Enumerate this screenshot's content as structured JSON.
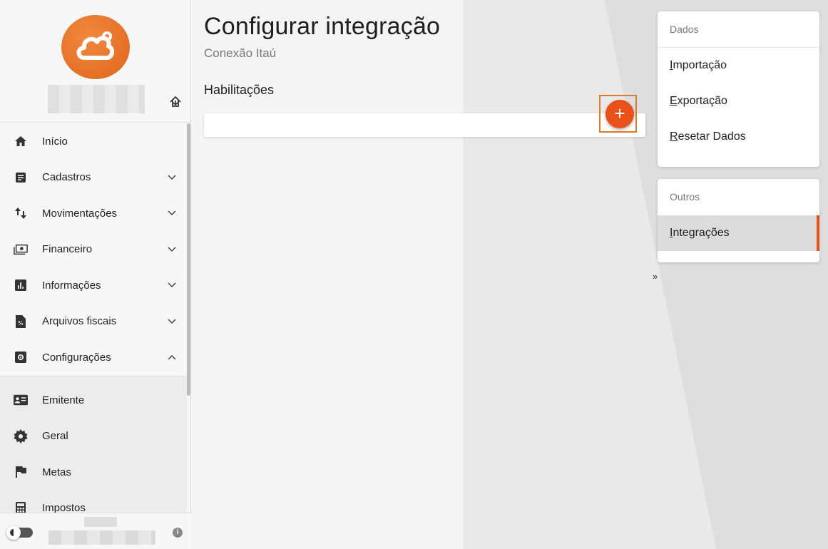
{
  "colors": {
    "accent": "#e8501c",
    "logo": "#e8701f",
    "highlight": "#e07a2b"
  },
  "sidebar": {
    "logo_icon": "cloud-logo-icon",
    "logout_icon": "logout-icon",
    "menu": [
      {
        "label": "Início",
        "icon": "home-icon",
        "chevron": false
      },
      {
        "label": "Cadastros",
        "icon": "document-icon",
        "chevron": "down"
      },
      {
        "label": "Movimentações",
        "icon": "swap-vertical-icon",
        "chevron": "down"
      },
      {
        "label": "Financeiro",
        "icon": "money-icon",
        "chevron": "down"
      },
      {
        "label": "Informações",
        "icon": "bar-chart-icon",
        "chevron": "down"
      },
      {
        "label": "Arquivos fiscais",
        "icon": "fiscal-file-icon",
        "chevron": "down"
      },
      {
        "label": "Configurações",
        "icon": "settings-box-icon",
        "chevron": "up"
      }
    ],
    "submenu": [
      {
        "label": "Emitente",
        "icon": "id-card-icon"
      },
      {
        "label": "Geral",
        "icon": "gear-icon"
      },
      {
        "label": "Metas",
        "icon": "flag-icon"
      },
      {
        "label": "Impostos",
        "icon": "calculator-icon"
      }
    ],
    "footer": {
      "info_label": "i"
    }
  },
  "main": {
    "title": "Configurar integração",
    "subtitle": "Conexão Itaú",
    "section": "Habilitações",
    "add_label": "+"
  },
  "right_panel": {
    "dados": {
      "header": "Dados",
      "items": [
        {
          "first": "I",
          "rest": "mportação"
        },
        {
          "first": "E",
          "rest": "xportação"
        },
        {
          "first": "R",
          "rest": "esetar Dados"
        }
      ]
    },
    "outros": {
      "header": "Outros",
      "items": [
        {
          "first": "I",
          "rest": "ntegrações",
          "active": true
        }
      ]
    },
    "collapse_label": "»"
  }
}
